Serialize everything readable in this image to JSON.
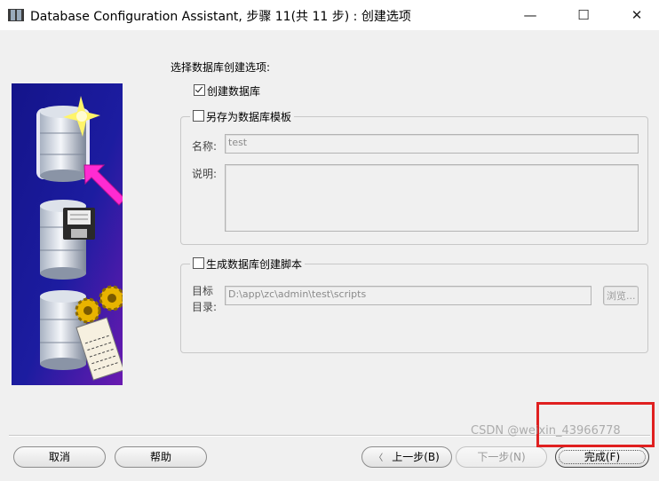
{
  "window": {
    "title": "Database Configuration Assistant, 步骤 11(共 11 步) : 创建选项",
    "minimize_icon": "minimize-icon",
    "maximize_icon": "maximize-icon",
    "close_icon": "close-icon"
  },
  "options": {
    "heading": "选择数据库创建选项:",
    "create_db": {
      "label": "创建数据库",
      "checked": true
    },
    "save_template": {
      "label": "另存为数据库模板",
      "checked": false,
      "name_label": "名称:",
      "name_value": "test",
      "desc_label": "说明:",
      "desc_value": ""
    },
    "gen_scripts": {
      "label": "生成数据库创建脚本",
      "checked": false,
      "dir_label_line1": "目标",
      "dir_label_line2": "目录:",
      "dir_value": "D:\\app\\zc\\admin\\test\\scripts",
      "browse_label": "浏览..."
    }
  },
  "buttons": {
    "cancel": "取消",
    "help": "帮助",
    "back": "上一步(B)",
    "next": "下一步(N)",
    "finish": "完成(F)"
  },
  "watermark": "CSDN @weixin_43966778",
  "colors": {
    "highlight": "#e02020",
    "panel_bg": "#f0f0f0",
    "image_bg": "#1a1a8a"
  }
}
